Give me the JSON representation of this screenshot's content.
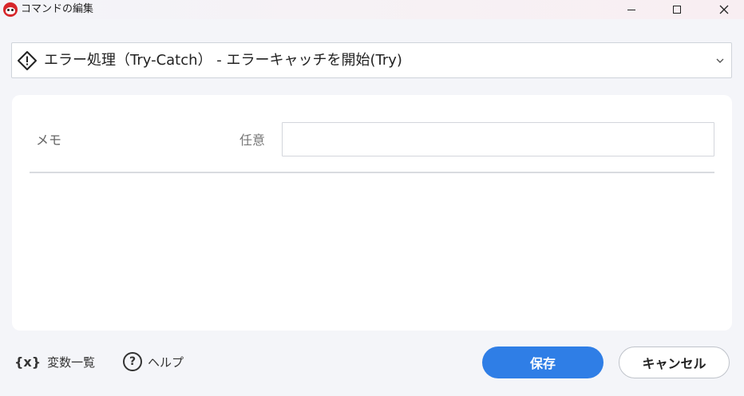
{
  "window": {
    "title": "コマンドの編集",
    "icon": "app-mascot-icon",
    "controls": [
      "minimize",
      "maximize",
      "close"
    ]
  },
  "command": {
    "icon": "warning-diamond-icon",
    "label": "エラー処理（Try-Catch） - エラーキャッチを開始(Try)"
  },
  "form": {
    "memo_label": "メモ",
    "optional_label": "任意",
    "memo_value": "",
    "memo_placeholder": ""
  },
  "footer": {
    "vars_icon": "{x}",
    "vars_label": "変数一覧",
    "help_icon": "?",
    "help_label": "ヘルプ",
    "save_label": "保存",
    "cancel_label": "キャンセル"
  },
  "colors": {
    "primary": "#2f7ee6",
    "background": "#f4f5f9",
    "panel": "#ffffff"
  }
}
